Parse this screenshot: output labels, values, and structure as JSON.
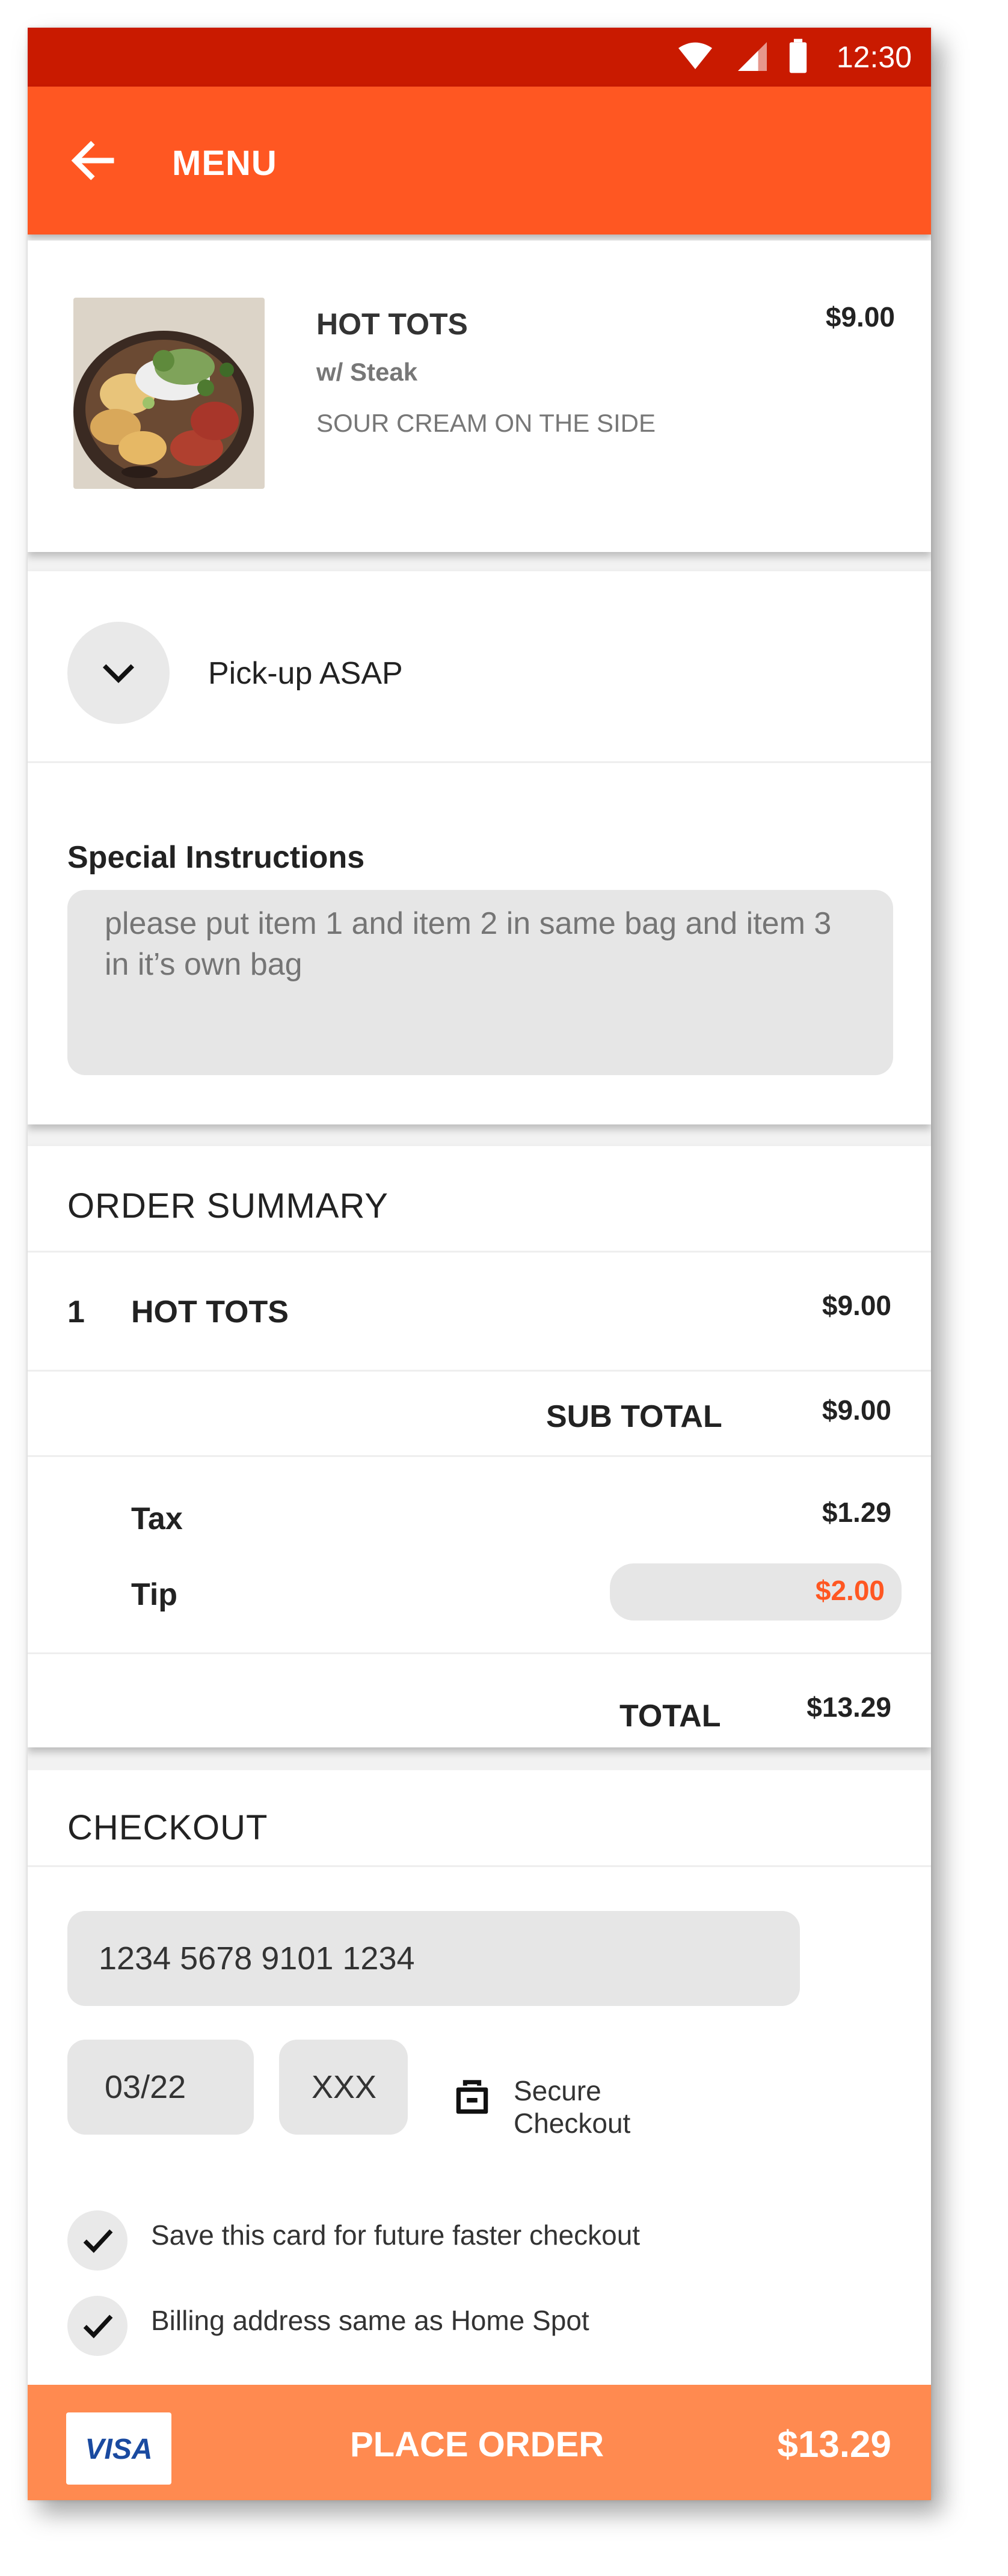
{
  "status_bar": {
    "time": "12:30"
  },
  "app_bar": {
    "title": "MENU"
  },
  "item": {
    "name": "HOT TOTS",
    "modifier": "w/ Steak",
    "note": "SOUR CREAM ON THE SIDE",
    "price": "$9.00"
  },
  "pickup": {
    "label": "Pick-up ASAP"
  },
  "instructions": {
    "label": "Special Instructions",
    "placeholder": "please put item 1 and item 2 in same bag and item 3 in it’s own bag"
  },
  "order_summary": {
    "heading": "ORDER SUMMARY",
    "line_item": {
      "qty": "1",
      "name": "HOT TOTS",
      "price": "$9.00"
    },
    "subtotal_label": "SUB TOTAL",
    "subtotal": "$9.00",
    "tax_label": "Tax",
    "tax": "$1.29",
    "tip_label": "Tip",
    "tip": "$2.00",
    "total_label": "TOTAL",
    "total": "$13.29"
  },
  "checkout": {
    "heading": "CHECKOUT",
    "card_number": "1234 5678 9101 1234",
    "expiry": "03/22",
    "cvv": "XXX",
    "secure_label": "Secure Checkout",
    "save_card_label": "Save this card for future faster checkout",
    "billing_label": "Billing address same as Home Spot"
  },
  "footer": {
    "card_brand": "VISA",
    "place_order_label": "PLACE ORDER",
    "total": "$13.29"
  },
  "colors": {
    "status_bar": "#c91a00",
    "app_bar": "#ff5722",
    "footer": "#ff8a50",
    "tip_text": "#ff5722"
  }
}
